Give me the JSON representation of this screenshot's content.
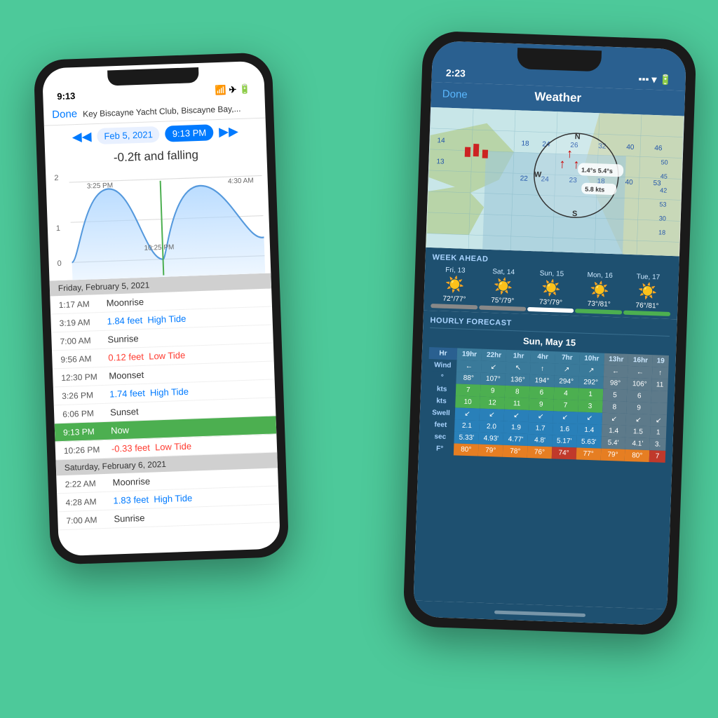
{
  "background": "#4dc99a",
  "left_phone": {
    "status_time": "9:13",
    "header": {
      "done": "Done",
      "title": "Key Biscayne Yacht Club, Biscayne Bay,..."
    },
    "date_nav": {
      "date": "Feb 5, 2021",
      "time": "9:13 PM"
    },
    "tide_status": "-0.2ft and falling",
    "chart": {
      "label_2": "2",
      "label_1": "1",
      "label_0": "0",
      "time_1": "3:25 PM",
      "time_2": "4:30 AM",
      "time_3": "10:25 PM"
    },
    "day1_header": "Friday, February 5, 2021",
    "rows_day1": [
      {
        "time": "1:17 AM",
        "desc": "Moonrise",
        "type": "normal"
      },
      {
        "time": "3:19 AM",
        "desc": "1.84 feet  High Tide",
        "type": "high"
      },
      {
        "time": "7:00 AM",
        "desc": "Sunrise",
        "type": "normal"
      },
      {
        "time": "9:56 AM",
        "desc": "0.12 feet  Low Tide",
        "type": "low"
      },
      {
        "time": "12:30 PM",
        "desc": "Moonset",
        "type": "normal"
      },
      {
        "time": "3:26 PM",
        "desc": "1.74 feet  High Tide",
        "type": "high"
      },
      {
        "time": "6:06 PM",
        "desc": "Sunset",
        "type": "normal"
      },
      {
        "time": "9:13 PM",
        "desc": "Now",
        "type": "now"
      },
      {
        "time": "10:26 PM",
        "desc": "-0.33 feet  Low Tide",
        "type": "low_neg"
      }
    ],
    "day2_header": "Saturday, February 6, 2021",
    "rows_day2": [
      {
        "time": "2:22 AM",
        "desc": "Moonrise",
        "type": "normal"
      },
      {
        "time": "4:28 AM",
        "desc": "1.83 feet  High Tide",
        "type": "high"
      },
      {
        "time": "7:00 AM",
        "desc": "Sunrise",
        "type": "normal"
      }
    ]
  },
  "right_phone": {
    "status_time": "2:23",
    "header": {
      "done": "Done",
      "title": "Weather"
    },
    "map": {
      "wind_label": "1.4°s 5.4°s",
      "wind_speed": "5.8 kts"
    },
    "week_ahead": {
      "title": "WEEK AHEAD",
      "days": [
        {
          "name": "Fri, 13",
          "temp": "72°/77°",
          "bar": "gray"
        },
        {
          "name": "Sat, 14",
          "temp": "75°/79°",
          "bar": "gray"
        },
        {
          "name": "Sun, 15",
          "temp": "73°/79°",
          "bar": "white"
        },
        {
          "name": "Mon, 16",
          "temp": "73°/81°",
          "bar": "green"
        },
        {
          "name": "Tue, 17",
          "temp": "76°/81°",
          "bar": "green"
        }
      ]
    },
    "hourly": {
      "title": "HOURLY FORECAST",
      "day_label": "Sun, May 15",
      "columns": [
        "Hr",
        "19hr",
        "22hr",
        "1hr",
        "4hr",
        "7hr",
        "10hr",
        "13hr",
        "16hr",
        "19"
      ],
      "rows": [
        {
          "label": "Wind",
          "values": [
            "←",
            "↙",
            "↖",
            "↑",
            "↗",
            "↗",
            "←",
            "←",
            "↑"
          ],
          "type": "arrow"
        },
        {
          "label": "°",
          "values": [
            "88°",
            "107°",
            "136°",
            "194°",
            "294°",
            "292°",
            "",
            "98°",
            "106°",
            "11"
          ],
          "type": "normal"
        },
        {
          "label": "kts",
          "values": [
            "7",
            "9",
            "8",
            "6",
            "4",
            "1",
            "",
            "5",
            "6",
            ""
          ],
          "type": "highlight_top"
        },
        {
          "label": "kts",
          "values": [
            "10",
            "12",
            "11",
            "9",
            "7",
            "3",
            "",
            "8",
            "9",
            ""
          ],
          "type": "highlight_bot"
        },
        {
          "label": "Swell",
          "values": [
            "↙",
            "↙",
            "↙",
            "↙",
            "↙",
            "↙",
            "",
            "↙",
            "↙",
            "↙"
          ],
          "type": "arrow_swell"
        },
        {
          "label": "feet",
          "values": [
            "2.1",
            "2.0",
            "1.9",
            "1.7",
            "1.6",
            "1.4",
            "",
            "1.4",
            "1.5",
            "1"
          ],
          "type": "normal"
        },
        {
          "label": "sec",
          "values": [
            "5.33'",
            "4.93'",
            "4.77'",
            "4.8'",
            "5.17'",
            "5.63'",
            "",
            "5.4'",
            "4.1'",
            "3."
          ],
          "type": "normal"
        },
        {
          "label": "F°",
          "values": [
            "80°",
            "79°",
            "78°",
            "76°",
            "74°",
            "77°",
            "",
            "79°",
            "80°",
            "7"
          ],
          "type": "temp"
        }
      ]
    }
  }
}
